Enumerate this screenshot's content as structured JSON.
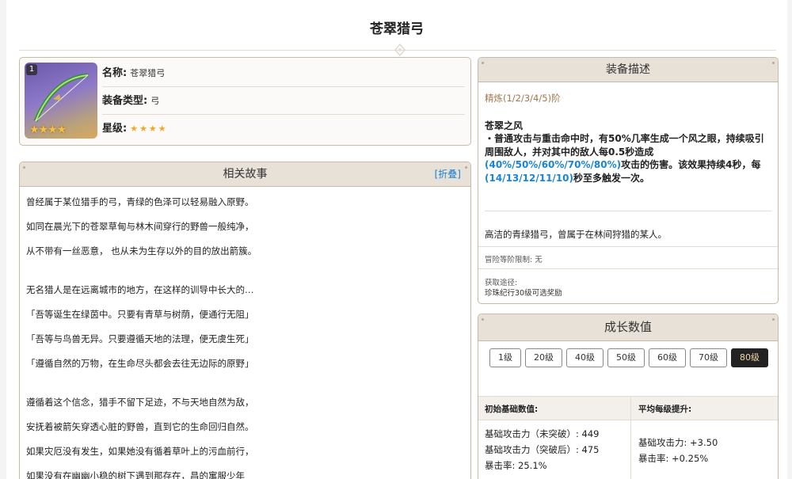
{
  "page_title": "苍翠猎弓",
  "card": {
    "level_badge": "1",
    "rarity_stars": "★★★★",
    "name_label": "名称:",
    "name_value": "苍翠猎弓",
    "type_label": "装备类型:",
    "type_value": "弓",
    "star_label": "星级:",
    "star_value": "★★★★"
  },
  "story": {
    "header": "相关故事",
    "fold_link": "[折叠]",
    "lines": [
      "曾经属于某位猎手的弓，青绿的色泽可以轻易融入原野。",
      "如同在晨光下的苍翠草甸与林木间穿行的野兽一般纯净，",
      "从不带有一丝恶意， 也从未为生存以外的目的放出箭簇。",
      "",
      "无名猎人是在远离城市的地方，在这样的训导中长大的…",
      "「吾等诞生在绿茵中。只要有青草与树荫，便通行无阻」",
      "「吾等与鸟兽无异。只要遵循天地的法理，便无虞生死」",
      "「遵循自然的万物，在生命尽头都会去往无边际的原野」",
      "",
      "遵循着这个信念，猎手不留下足迹，不与天地自然为敌，",
      "安抚着被箭矢穿透心脏的野兽，直到它的生命回归自然。",
      "如果灾厄没有发生，如果她没有循着草叶上的污血前行，",
      "如果没有在幽幽小稳的树下遇到那存在，昌的寓服少年"
    ]
  },
  "desc": {
    "header": "装备描述",
    "refine": "精炼(1/2/3/4/5)阶",
    "passive_name": "苍翠之风",
    "passive_t1": "・普通攻击与重击命中时，有50%几率生成一个风之眼，持续吸引周围敌人，并对其中的敌人每0.5秒造成",
    "passive_v1": "(40%/50%/60%/70%/80%)",
    "passive_t2": "攻击的伤害。该效果持续4秒，每",
    "passive_v2": "(14/13/12/11/10)",
    "passive_t3": "秒至多触发一次。",
    "flavor": "高洁的青绿猎弓，曾属于在林间狩猎的某人。",
    "ascension_limit": "冒险等阶限制: 无",
    "obtain_label": "获取途径:",
    "obtain_value": "珍珠纪行30级可选奖励"
  },
  "growth": {
    "header": "成长数值",
    "levels": [
      "1级",
      "20级",
      "40级",
      "50级",
      "60级",
      "70级",
      "80级"
    ],
    "active_level": "80级",
    "col1_header": "初始基础数值:",
    "col2_header": "平均每级提升:",
    "base_atk_pre": "基础攻击力（未突破）: 449",
    "base_atk_post": "基础攻击力（突破后）: 475",
    "crit_rate": "暴击率: 25.1%",
    "avg_atk": "基础攻击力: +3.50",
    "avg_crit": "暴击率: +0.25%"
  }
}
